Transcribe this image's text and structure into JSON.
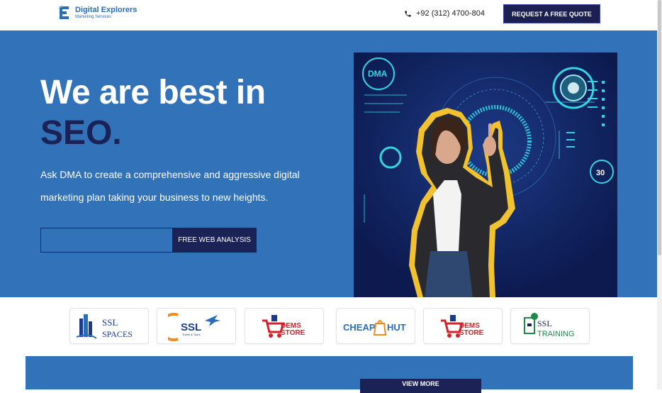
{
  "header": {
    "logo_title": "Digital Explorers",
    "logo_subtitle": "Marketing Services",
    "phone": "+92 (312) 4700-804",
    "quote_button": "REQUEST A FREE QUOTE"
  },
  "hero": {
    "heading_line1": "We are best in",
    "heading_line2": "SEO.",
    "description": "Ask DMA to create a comprehensive and aggressive digital marketing plan taking your business to new heights.",
    "input_placeholder": "",
    "cta_button": "FREE WEB ANALYSIS",
    "image_badge": "DMA",
    "image_counter": "30"
  },
  "partners": [
    {
      "name": "SSL SPACES",
      "line1": "SSL",
      "line2": "SPACES"
    },
    {
      "name": "SSL Travel",
      "line1": "SSL",
      "line2": "Travel & Tours"
    },
    {
      "name": "DEMS STORE",
      "line1": "DEMS",
      "line2": "STORE"
    },
    {
      "name": "CHEAP HUT",
      "line1": "CHEAP",
      "line2": "HUT"
    },
    {
      "name": "DEMS STORE",
      "line1": "DEMS",
      "line2": "STORE"
    },
    {
      "name": "SSL TRAINING",
      "line1": "SSL",
      "line2": "TRAINING"
    }
  ],
  "bottom": {
    "button": "VIEW MORE"
  },
  "colors": {
    "primary_blue": "#3172b9",
    "navy": "#1b2256",
    "accent_yellow": "#f2c12e",
    "cyan_hud": "#33d6e0"
  }
}
